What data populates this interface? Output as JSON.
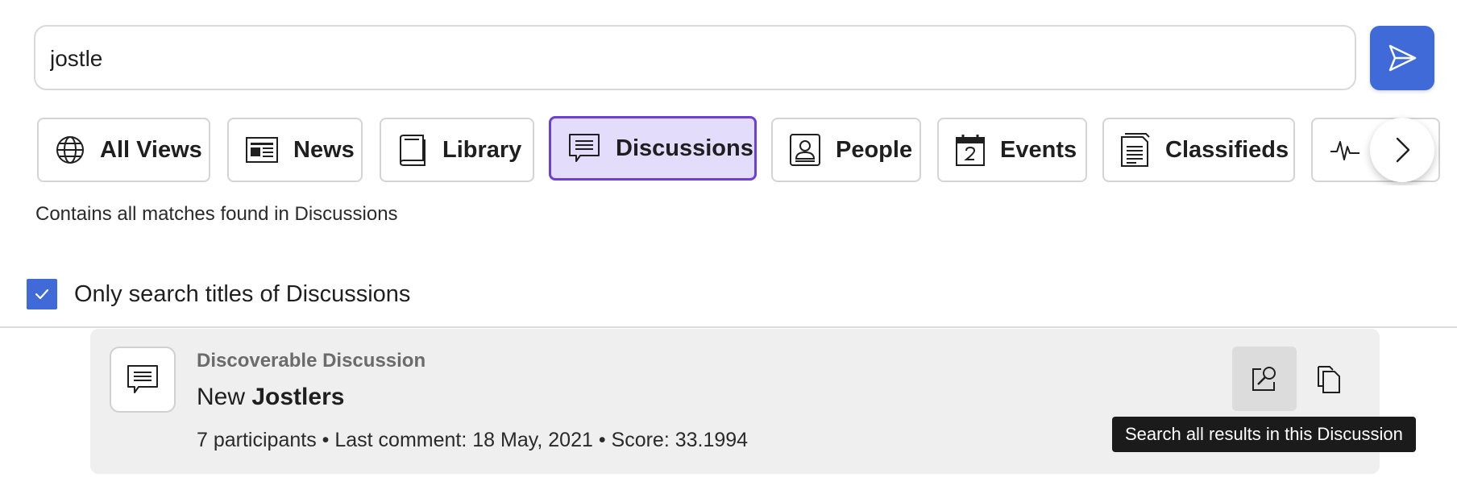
{
  "search": {
    "value": "jostle",
    "placeholder": "",
    "submit_icon": "send-icon"
  },
  "tabs": [
    {
      "label": "All Views",
      "icon": "globe-icon"
    },
    {
      "label": "News",
      "icon": "newspaper-icon"
    },
    {
      "label": "Library",
      "icon": "book-icon"
    },
    {
      "label": "Discussions",
      "icon": "speech-bubble-icon",
      "active": true
    },
    {
      "label": "People",
      "icon": "person-card-icon"
    },
    {
      "label": "Events",
      "icon": "calendar-icon"
    },
    {
      "label": "Classifieds",
      "icon": "document-stack-icon"
    },
    {
      "label": "",
      "icon": "activity-pulse-icon"
    }
  ],
  "view_description": "Contains all matches found in Discussions",
  "filter": {
    "checked": true,
    "label": "Only search titles of Discussions"
  },
  "result": {
    "type": "Discoverable Discussion",
    "title_prefix": "New ",
    "title_match": "Jostlers",
    "meta": "7 participants • Last comment: 18 May, 2021 • Score: 33.1994"
  },
  "tooltip": "Search all results in this Discussion",
  "colors": {
    "accent": "#3f6ad8",
    "active_tab_border": "#6c3fd6",
    "active_tab_bg": "#e4dcfb",
    "card_bg": "#efefef"
  }
}
